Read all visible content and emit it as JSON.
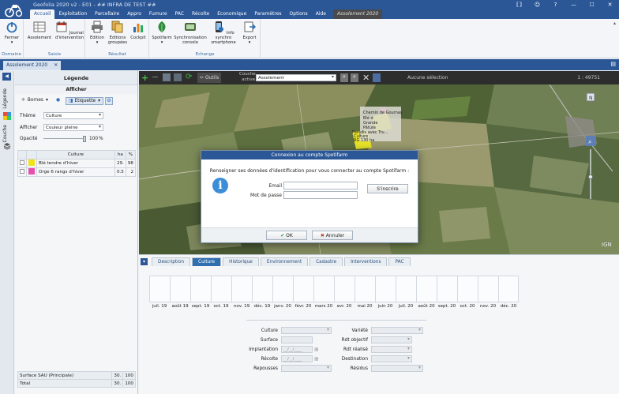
{
  "window": {
    "title": "Geofolia 2020 v2 - E01 - ## INFRA DE TEST ##",
    "controls": [
      "⟦⟧",
      "☺",
      "?",
      "—",
      "☐",
      "✕"
    ]
  },
  "menu": {
    "tabs": [
      "Accueil",
      "Exploitation",
      "Parcellaire",
      "Appro",
      "Fumure",
      "PAC",
      "Récolte",
      "Economique",
      "Paramètres",
      "Options",
      "Aide"
    ],
    "context_tab": "Assolement 2020"
  },
  "ribbon": {
    "groups": [
      {
        "label": "Domaine",
        "buttons": [
          "Fermer"
        ]
      },
      {
        "label": "Saisie",
        "buttons": [
          "Assolement",
          "Journal d'intervention"
        ]
      },
      {
        "label": "Résultat",
        "buttons": [
          "Edition",
          "Editions groupées",
          "Cockpit"
        ]
      },
      {
        "label": "Echange",
        "buttons": [
          "Spotifarm",
          "Synchronisation console",
          "Info synchro smartphone",
          "Export"
        ]
      }
    ]
  },
  "doc_tab": {
    "label": "Assolement 2020",
    "close": "✕"
  },
  "side_strip": {
    "labels": [
      "Légende",
      "Couche"
    ]
  },
  "legend": {
    "title": "Légende",
    "afficher_title": "Afficher",
    "bornes": "Bornes",
    "etiquette": "Etiquette",
    "theme_label": "Thème",
    "theme_value": "Culture",
    "afficher_label": "Afficher",
    "afficher_value": "Couleur pleine",
    "opacite_label": "Opacité",
    "opacite_value": "100",
    "opacite_unit": "%",
    "opacity_fraction": 1.0,
    "columns": [
      "Culture",
      "ha",
      "%"
    ],
    "rows": [
      {
        "color": "#f1e21a",
        "culture": "Blé tendre d'hiver",
        "ha": "29.",
        "pct": "98"
      },
      {
        "color": "#e64fae",
        "culture": "Orge 6 rangs d'hiver",
        "ha": "0.5",
        "pct": "2"
      }
    ],
    "totals": [
      {
        "label": "Surface SAU (Principale)",
        "ha": "30.",
        "pct": "100"
      },
      {
        "label": "Total",
        "ha": "30.",
        "pct": "100"
      }
    ]
  },
  "map_toolbar": {
    "outils": "Outils",
    "couche_label": "Couche active",
    "couche_value": "Assolement",
    "selection": "Aucune sélection",
    "scale": "1 : 49751"
  },
  "map": {
    "labels": [
      "Chemin de Gournay",
      "Blé d",
      "Grande",
      "Pâture",
      "Paradis avec Tru…",
      "Culture",
      "RG 130 ha"
    ],
    "north": "N",
    "zoom_icon": "⌕",
    "watermark": "IGN"
  },
  "dialog": {
    "title": "Connexion au compte Spotifarm",
    "message": "Renseigner ses données d'identification pour vous connecter au compte Spotifarm :",
    "email_label": "Email",
    "password_label": "Mot de passe",
    "register": "S'inscrire",
    "ok": "OK",
    "cancel": "Annuler"
  },
  "bottom": {
    "tabs": [
      "Description",
      "Culture",
      "Historique",
      "Environnement",
      "Cadastre",
      "Interventions",
      "PAC"
    ],
    "active_tab": 1,
    "months": [
      "juil. 19",
      "août 19",
      "sept. 19",
      "oct. 19",
      "nov. 19",
      "déc. 19",
      "janv. 20",
      "févr. 20",
      "mars 20",
      "avr. 20",
      "mai 20",
      "juin 20",
      "juil. 20",
      "août 20",
      "sept. 20",
      "oct. 20",
      "nov. 20",
      "déc. 20"
    ],
    "form_left": [
      {
        "label": "Culture",
        "value": ""
      },
      {
        "label": "Surface",
        "value": ""
      },
      {
        "label": "Implantation",
        "value": "__/__/____"
      },
      {
        "label": "Récolte",
        "value": "__/__/____"
      },
      {
        "label": "Repousses",
        "value": ""
      }
    ],
    "form_right": [
      {
        "label": "Variété",
        "value": ""
      },
      {
        "label": "Rdt objectif",
        "value": ""
      },
      {
        "label": "Rdt réalisé",
        "value": ""
      },
      {
        "label": "Destination",
        "value": ""
      },
      {
        "label": "Résidus",
        "value": ""
      }
    ]
  }
}
